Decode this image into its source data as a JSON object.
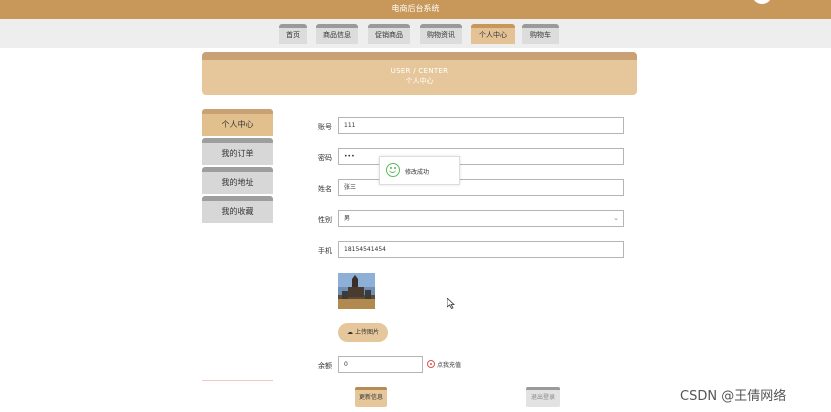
{
  "header": {
    "site_title": "电商后台系统"
  },
  "nav": {
    "items": [
      {
        "label": "首页"
      },
      {
        "label": "商品信息"
      },
      {
        "label": "促销商品"
      },
      {
        "label": "购物资讯"
      },
      {
        "label": "个人中心"
      },
      {
        "label": "购物车"
      }
    ],
    "active": "个人中心"
  },
  "banner": {
    "title_en": "USER / CENTER",
    "title_cn": "个人中心"
  },
  "sidebar": {
    "items": [
      {
        "label": "个人中心"
      },
      {
        "label": "我的订单"
      },
      {
        "label": "我的地址"
      },
      {
        "label": "我的收藏"
      }
    ],
    "active": "个人中心"
  },
  "form": {
    "account": {
      "label": "账号",
      "value": "111"
    },
    "password": {
      "label": "密码",
      "value": "•••"
    },
    "name": {
      "label": "姓名",
      "value": "张三"
    },
    "gender": {
      "label": "性别",
      "value": "男"
    },
    "phone": {
      "label": "手机",
      "value": "18154541454"
    },
    "upload_label": "上传图片",
    "balance": {
      "label": "余额",
      "value": "0"
    },
    "recharge_label": "点我充值",
    "update_label": "更新信息",
    "logout_label": "退出登录"
  },
  "toast": {
    "message": "修改成功",
    "color": "#5cb85c"
  },
  "watermark": "CSDN @王倩网络",
  "colors": {
    "primary": "#c8975a",
    "accent_light": "#e6c79b"
  }
}
